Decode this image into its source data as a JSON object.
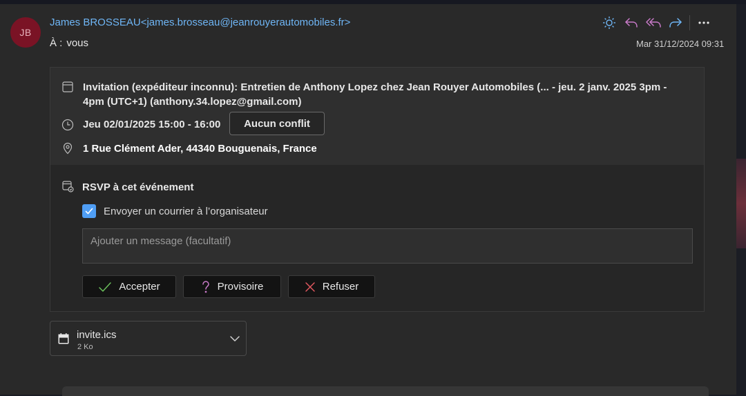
{
  "sender": {
    "initials": "JB",
    "name": "James BROSSEAU",
    "email": "<james.brosseau@jeanrouyerautomobiles.fr>"
  },
  "recipient": {
    "label": "À :",
    "value": "vous"
  },
  "datetime": "Mar 31/12/2024 09:31",
  "toolbar": {
    "icons": [
      "sun-icon",
      "reply-icon",
      "reply-all-icon",
      "forward-icon",
      "more-icon"
    ],
    "colors": {
      "sun": "#6fb6f6",
      "reply": "#c97ac9",
      "forward": "#6fb6f6"
    }
  },
  "invitation": {
    "title": "Invitation (expéditeur inconnu): Entretien de Anthony Lopez chez Jean Rouyer Automobiles (... - jeu. 2 janv. 2025 3pm - 4pm (UTC+1) (anthony.34.lopez@gmail.com)",
    "when": "Jeu 02/01/2025 15:00 - 16:00",
    "conflict_label": "Aucun conflit",
    "location": "1 Rue Clément Ader, 44340 Bouguenais, France"
  },
  "rsvp": {
    "title": "RSVP à cet événement",
    "send_mail_checked": true,
    "send_mail_label": "Envoyer un courrier à l’organisateur",
    "message_placeholder": "Ajouter un message (facultatif)",
    "buttons": {
      "accept": "Accepter",
      "tentative": "Provisoire",
      "decline": "Refuser"
    }
  },
  "attachment": {
    "name": "invite.ics",
    "size": "2 Ko"
  }
}
